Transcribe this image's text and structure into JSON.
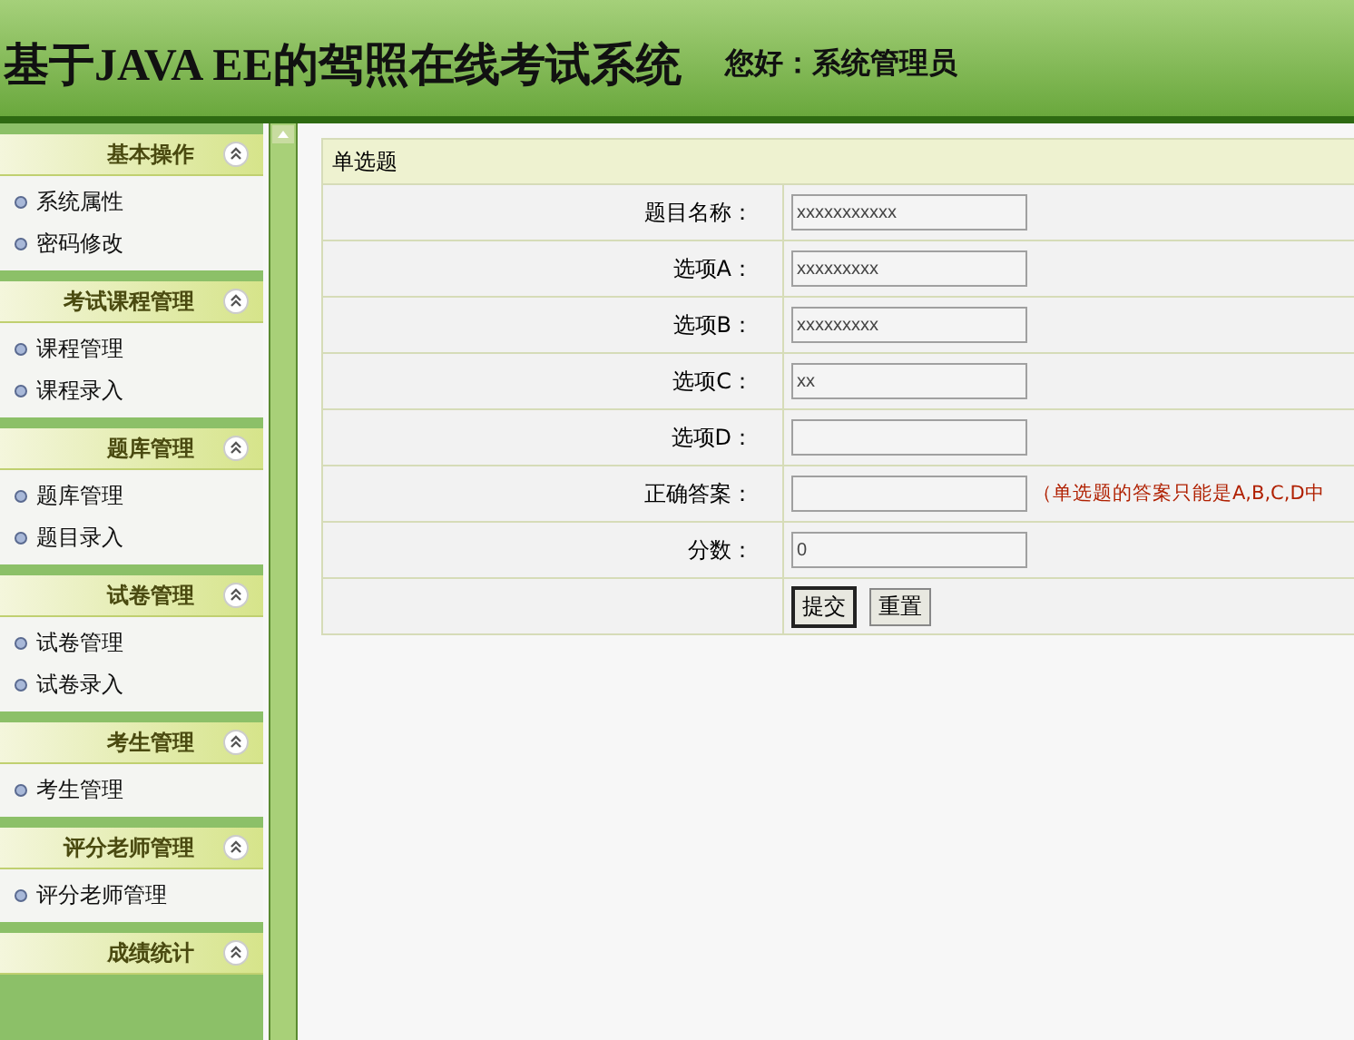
{
  "header": {
    "title": "基于JAVA EE的驾照在线考试系统",
    "greeting": "您好：系统管理员"
  },
  "sidebar": {
    "sections": [
      {
        "title": "基本操作",
        "expanded": true,
        "items": [
          "系统属性",
          "密码修改"
        ]
      },
      {
        "title": "考试课程管理",
        "expanded": true,
        "items": [
          "课程管理",
          "课程录入"
        ]
      },
      {
        "title": "题库管理",
        "expanded": true,
        "items": [
          "题库管理",
          "题目录入"
        ]
      },
      {
        "title": "试卷管理",
        "expanded": true,
        "items": [
          "试卷管理",
          "试卷录入"
        ]
      },
      {
        "title": "考生管理",
        "expanded": true,
        "items": [
          "考生管理"
        ]
      },
      {
        "title": "评分老师管理",
        "expanded": true,
        "items": [
          "评分老师管理"
        ]
      },
      {
        "title": "成绩统计",
        "expanded": true
      }
    ]
  },
  "form": {
    "title": "单选题",
    "fields": [
      {
        "label": "题目名称：",
        "value": "xxxxxxxxxxx"
      },
      {
        "label": "选项A：",
        "value": "xxxxxxxxx"
      },
      {
        "label": "选项B：",
        "value": "xxxxxxxxx"
      },
      {
        "label": "选项C：",
        "value": "xx"
      },
      {
        "label": "选项D："
      },
      {
        "label": "正确答案：",
        "hint": "（单选题的答案只能是A,B,C,D中"
      },
      {
        "label": "分数：",
        "value": "0"
      }
    ],
    "buttons": [
      "提交",
      "重置"
    ]
  }
}
